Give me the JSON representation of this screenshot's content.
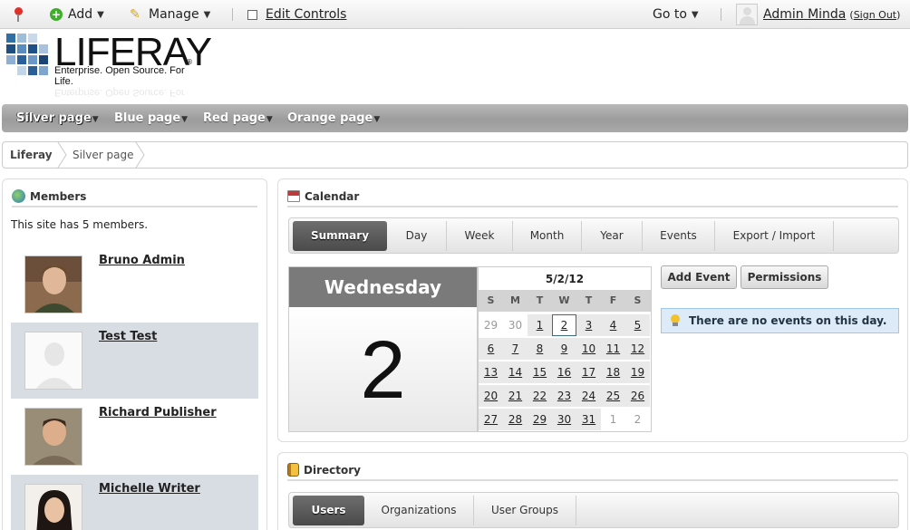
{
  "dockbar": {
    "add_label": "Add",
    "manage_label": "Manage",
    "edit_controls_label": "Edit Controls",
    "goto_label": "Go to",
    "user_name": "Admin Minda",
    "sign_out_open": "(",
    "sign_out_label": "Sign Out",
    "sign_out_close": ")"
  },
  "header": {
    "logo_word": "LIFERAY",
    "logo_tagline": "Enterprise. Open Source. For Life.",
    "logo_registered": "®"
  },
  "nav": {
    "items": [
      {
        "label": "Silver page",
        "selected": true
      },
      {
        "label": "Blue page",
        "selected": false
      },
      {
        "label": "Red page",
        "selected": false
      },
      {
        "label": "Orange page",
        "selected": false
      }
    ]
  },
  "breadcrumb": {
    "items": [
      "Liferay",
      "Silver page"
    ]
  },
  "members": {
    "title": "Members",
    "count_text": "This site has 5 members.",
    "list": [
      {
        "name": "Bruno Admin"
      },
      {
        "name": "Test Test"
      },
      {
        "name": "Richard Publisher"
      },
      {
        "name": "Michelle Writer"
      }
    ]
  },
  "calendar": {
    "title": "Calendar",
    "tabs": [
      "Summary",
      "Day",
      "Week",
      "Month",
      "Year",
      "Events",
      "Export / Import"
    ],
    "active_tab": "Summary",
    "weekday": "Wednesday",
    "day_number": "2",
    "mini_title": "5/2/12",
    "dow": [
      "S",
      "M",
      "T",
      "W",
      "T",
      "F",
      "S"
    ],
    "weeks": [
      [
        "29",
        "30",
        "1",
        "2",
        "3",
        "4",
        "5"
      ],
      [
        "6",
        "7",
        "8",
        "9",
        "10",
        "11",
        "12"
      ],
      [
        "13",
        "14",
        "15",
        "16",
        "17",
        "18",
        "19"
      ],
      [
        "20",
        "21",
        "22",
        "23",
        "24",
        "25",
        "26"
      ],
      [
        "27",
        "28",
        "29",
        "30",
        "31",
        "1",
        "2"
      ]
    ],
    "today": "2",
    "add_event_label": "Add Event",
    "permissions_label": "Permissions",
    "no_events_text": "There are no events on this day."
  },
  "directory": {
    "title": "Directory",
    "tabs": [
      "Users",
      "Organizations",
      "User Groups"
    ],
    "active_tab": "Users"
  },
  "colors": {
    "nav_bar": "#a8a8a8",
    "active_tab": "#555555",
    "info_box": "#dcebf7",
    "member_row_shade": "#d8dce3"
  }
}
